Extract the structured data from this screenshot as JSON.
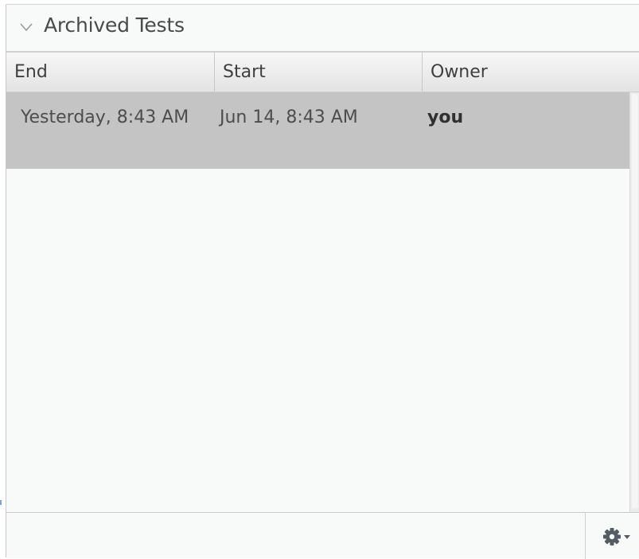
{
  "panel": {
    "title": "Archived Tests",
    "collapse_icon": "chevron-down-icon"
  },
  "columns": [
    {
      "label": "End"
    },
    {
      "label": "Start"
    },
    {
      "label": "Owner"
    }
  ],
  "rows": [
    {
      "end": "Yesterday, 8:43 AM",
      "start": "Jun 14, 8:43 AM",
      "owner": "you",
      "selected": true
    }
  ],
  "footer": {
    "settings_icon": "gear-dropdown-icon"
  },
  "colors": {
    "panel_bg": "#f8f9f9",
    "selected_row": "#c4c4c4",
    "text": "#4d4d4d"
  }
}
